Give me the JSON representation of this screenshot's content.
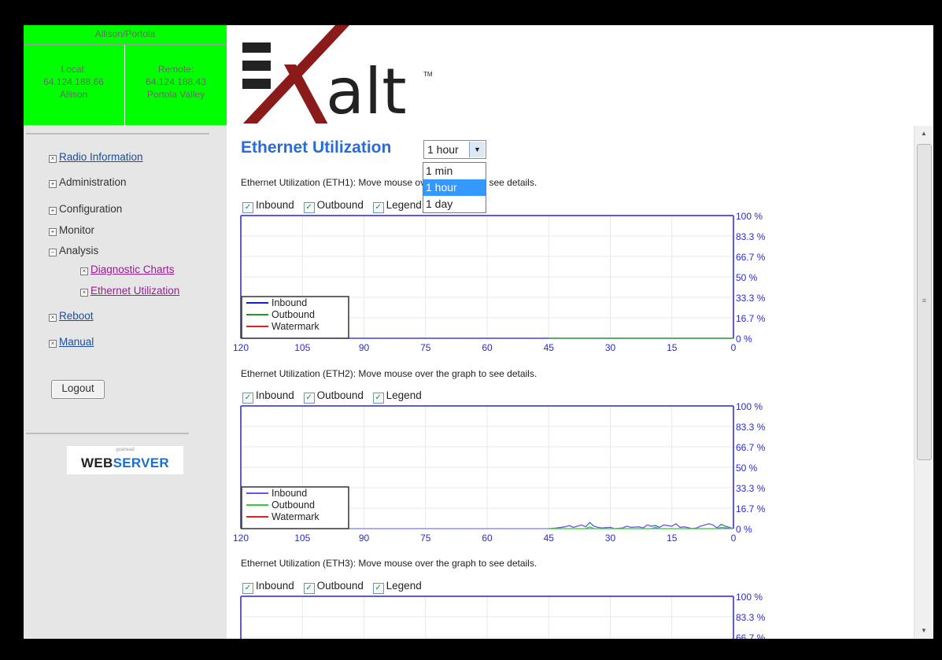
{
  "sidebar": {
    "link_name": "Allison/Portola",
    "local": {
      "label": "Local:",
      "ip": "64.124.188.66",
      "name": "Allison"
    },
    "remote": {
      "label": "Remote:",
      "ip": "64.124.188.43",
      "name": "Portola Valley"
    },
    "nav": {
      "radio_information": "Radio Information",
      "administration": "Administration",
      "configuration": "Configuration",
      "monitor": "Monitor",
      "analysis": "Analysis",
      "diagnostic_charts": "Diagnostic Charts",
      "ethernet_utilization": "Ethernet Utilization",
      "reboot": "Reboot",
      "manual": "Manual"
    },
    "logout_label": "Logout",
    "webserver_logo": {
      "small": "goahead",
      "word1": "WEB",
      "word2": "SERVER"
    }
  },
  "header": {
    "logo_text": "alt",
    "logo_tm": "TM"
  },
  "main": {
    "title": "Ethernet Utilization",
    "range": {
      "selected": "1 hour",
      "options": [
        "1 min",
        "1 hour",
        "1 day"
      ],
      "highlighted": "1 hour"
    },
    "checkbox_labels": {
      "inbound": "Inbound",
      "outbound": "Outbound",
      "legend": "Legend"
    }
  },
  "chart_data": [
    {
      "type": "line",
      "title": "Ethernet Utilization (ETH1): Move mouse over the graph to see details.",
      "x_ticks": [
        "120",
        "105",
        "90",
        "75",
        "60",
        "45",
        "30",
        "15",
        "0"
      ],
      "y_ticks": [
        "100 %",
        "83.3 %",
        "66.7 %",
        "50 %",
        "33.3 %",
        "16.7 %",
        "0 %"
      ],
      "xlim": [
        120,
        0
      ],
      "ylim": [
        0,
        100
      ],
      "legend": [
        "Inbound",
        "Outbound",
        "Watermark"
      ],
      "legend_position": "bottom-left",
      "grid": true,
      "colors": {
        "inbound": "#1a1ad0",
        "outbound": "#1e9a1e",
        "watermark": "#e02020",
        "frame": "#5a5ae6"
      },
      "series": [
        {
          "name": "Inbound",
          "x": [
            120,
            45,
            0
          ],
          "y": [
            0,
            0,
            0
          ]
        },
        {
          "name": "Outbound",
          "x": [
            45,
            0
          ],
          "y": [
            0,
            0
          ]
        }
      ]
    },
    {
      "type": "line",
      "title": "Ethernet Utilization (ETH2): Move mouse over the graph to see details.",
      "x_ticks": [
        "120",
        "105",
        "90",
        "75",
        "60",
        "45",
        "30",
        "15",
        "0"
      ],
      "y_ticks": [
        "100 %",
        "83.3 %",
        "66.7 %",
        "50 %",
        "33.3 %",
        "16.7 %",
        "0 %"
      ],
      "xlim": [
        120,
        0
      ],
      "ylim": [
        0,
        100
      ],
      "legend": [
        "Inbound",
        "Outbound",
        "Watermark"
      ],
      "legend_position": "bottom-left",
      "grid": true,
      "colors": {
        "inbound": "#5a5ae6",
        "outbound": "#33cc33",
        "watermark": "#e02020",
        "frame": "#5a5ae6"
      },
      "series": [
        {
          "name": "Inbound",
          "x": [
            45,
            43,
            41,
            40,
            39,
            37,
            36,
            35,
            34,
            33,
            32,
            30,
            29,
            27,
            26,
            25,
            23,
            22,
            21,
            20,
            19,
            18,
            17,
            15,
            14,
            13,
            12,
            10,
            9,
            8,
            6,
            5,
            4,
            3,
            2,
            1,
            0
          ],
          "y": [
            0,
            0.5,
            1.5,
            2.5,
            1,
            3,
            1.5,
            5,
            2,
            1,
            0.5,
            1,
            0,
            0.5,
            2,
            1,
            1.5,
            0.5,
            3,
            2,
            2.5,
            1,
            3,
            2,
            4,
            1,
            1.5,
            0,
            0.5,
            2,
            4,
            3,
            0.5,
            3.5,
            2,
            1,
            0
          ]
        },
        {
          "name": "Outbound",
          "x": [
            45,
            36,
            35,
            34,
            20,
            19,
            18,
            4,
            3,
            0
          ],
          "y": [
            0,
            0,
            1.5,
            0,
            0,
            1,
            0,
            0,
            1,
            0
          ]
        }
      ]
    },
    {
      "type": "line",
      "title": "Ethernet Utilization (ETH3): Move mouse over the graph to see details.",
      "y_ticks": [
        "100 %",
        "83.3 %",
        "66.7 %"
      ],
      "ylim": [
        0,
        100
      ],
      "grid": true,
      "colors": {
        "frame": "#5a5ae6"
      }
    }
  ]
}
